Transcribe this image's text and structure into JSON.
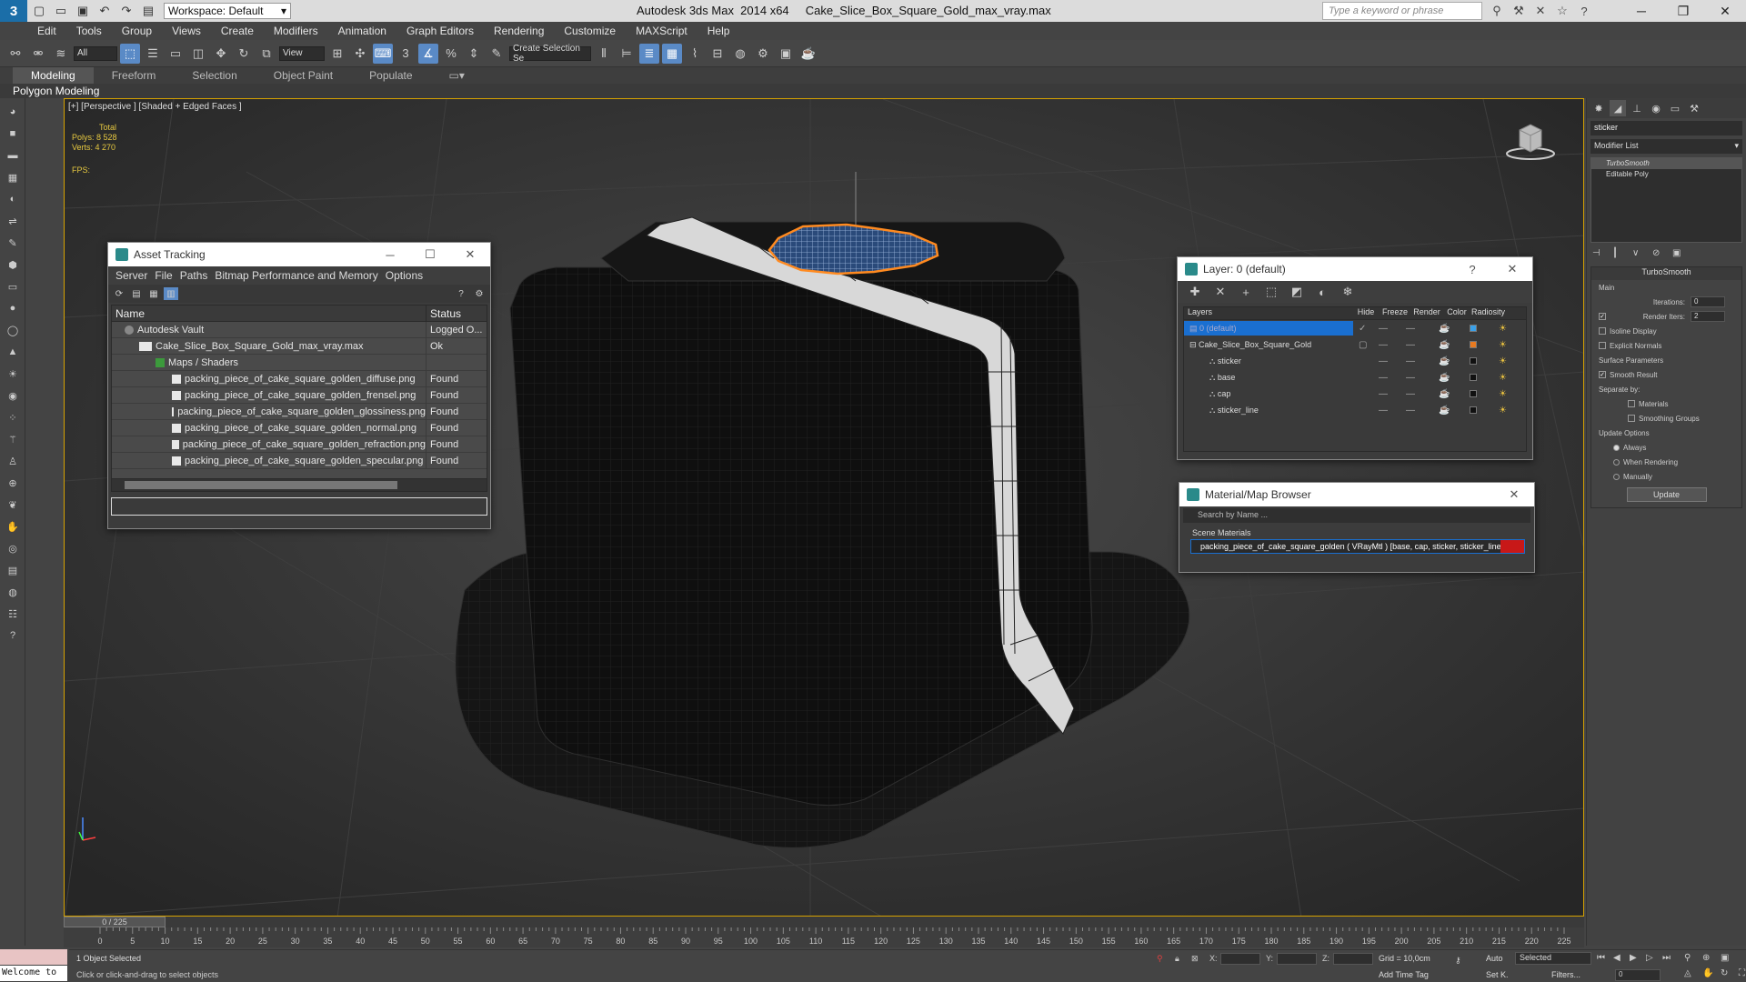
{
  "titlebar": {
    "workspace": "Workspace: Default",
    "title": "Autodesk 3ds Max  2014 x64     Cake_Slice_Box_Square_Gold_max_vray.max",
    "search_placeholder": "Type a keyword or phrase"
  },
  "menu": [
    "Edit",
    "Tools",
    "Group",
    "Views",
    "Create",
    "Modifiers",
    "Animation",
    "Graph Editors",
    "Rendering",
    "Customize",
    "MAXScript",
    "Help"
  ],
  "toolbar": {
    "filter": "All",
    "ref_coord": "View",
    "named_selection": "Create Selection Se"
  },
  "ribbon": {
    "tabs": [
      "Modeling",
      "Freeform",
      "Selection",
      "Object Paint",
      "Populate"
    ],
    "active_tab": "Modeling",
    "sub_label": "Polygon Modeling"
  },
  "viewport": {
    "label": "[+] [Perspective ] [Shaded + Edged Faces ]",
    "stats_total": "Total",
    "polys_label": "Polys:",
    "polys_value": "8 528",
    "verts_label": "Verts:",
    "verts_value": "4 270",
    "fps_label": "FPS:"
  },
  "asset_tracking": {
    "title": "Asset Tracking",
    "menu": [
      "Server",
      "File",
      "Paths",
      "Bitmap Performance and Memory",
      "Options"
    ],
    "columns": [
      "Name",
      "Status"
    ],
    "rows": [
      {
        "name": "Autodesk Vault",
        "status": "Logged O..."
      },
      {
        "name": "Cake_Slice_Box_Square_Gold_max_vray.max",
        "status": "Ok"
      },
      {
        "name": "Maps / Shaders",
        "status": ""
      },
      {
        "name": "packing_piece_of_cake_square_golden_diffuse.png",
        "status": "Found"
      },
      {
        "name": "packing_piece_of_cake_square_golden_frensel.png",
        "status": "Found"
      },
      {
        "name": "packing_piece_of_cake_square_golden_glossiness.png",
        "status": "Found"
      },
      {
        "name": "packing_piece_of_cake_square_golden_normal.png",
        "status": "Found"
      },
      {
        "name": "packing_piece_of_cake_square_golden_refraction.png",
        "status": "Found"
      },
      {
        "name": "packing_piece_of_cake_square_golden_specular.png",
        "status": "Found"
      }
    ]
  },
  "layer_window": {
    "title": "Layer: 0 (default)",
    "columns": [
      "Layers",
      "Hide",
      "Freeze",
      "Render",
      "Color",
      "Radiosity"
    ],
    "rows": [
      {
        "name": "0 (default)",
        "color": "#3aa0e8"
      },
      {
        "name": "Cake_Slice_Box_Square_Gold",
        "color": "#e87a20"
      },
      {
        "name": "sticker",
        "color": "#111111"
      },
      {
        "name": "base",
        "color": "#111111"
      },
      {
        "name": "cap",
        "color": "#111111"
      },
      {
        "name": "sticker_line",
        "color": "#111111"
      }
    ]
  },
  "material_browser": {
    "title": "Material/Map Browser",
    "search_placeholder": "Search by Name ...",
    "group": "Scene Materials",
    "item": "packing_piece_of_cake_square_golden ( VRayMtl ) [base, cap, sticker, sticker_line]"
  },
  "command_panel": {
    "object_name": "sticker",
    "modifier_list": "Modifier List",
    "stack": [
      "TurboSmooth",
      "Editable Poly"
    ],
    "turbosmooth_title": "TurboSmooth",
    "main_label": "Main",
    "iterations_label": "Iterations:",
    "iterations_value": "0",
    "render_iters_label": "Render Iters:",
    "render_iters_value": "2",
    "isoline": "Isoline Display",
    "explicit_normals": "Explicit Normals",
    "surface_params": "Surface Parameters",
    "smooth_result": "Smooth Result",
    "separate_by": "Separate by:",
    "materials": "Materials",
    "smoothing_groups": "Smoothing Groups",
    "update_options": "Update Options",
    "always": "Always",
    "when_rendering": "When Rendering",
    "manually": "Manually",
    "update_button": "Update"
  },
  "timeline": {
    "frame": "0 / 225",
    "ticks": [
      "0",
      "5",
      "10",
      "15",
      "20",
      "25",
      "30",
      "35",
      "40",
      "45",
      "50",
      "55",
      "60",
      "65",
      "70",
      "75",
      "80",
      "85",
      "90",
      "95",
      "100",
      "105",
      "110",
      "115",
      "120",
      "125",
      "130",
      "135",
      "140",
      "145",
      "150",
      "155",
      "160",
      "165",
      "170",
      "175",
      "180",
      "185",
      "190",
      "195",
      "200",
      "205",
      "210",
      "215",
      "220",
      "225"
    ]
  },
  "status": {
    "listener": "Welcome to",
    "selection": "1 Object Selected",
    "prompt": "Click or click-and-drag to select objects",
    "x_label": "X:",
    "y_label": "Y:",
    "z_label": "Z:",
    "grid": "Grid = 10,0cm",
    "add_time_tag": "Add Time Tag",
    "auto": "Auto",
    "selected": "Selected",
    "set_k": "Set K.",
    "filters": "Filters...",
    "frame_value": "0"
  },
  "colors": {
    "accent": "#5a8ac6",
    "viewport_border": "#d6a200",
    "stats": "#e6c840",
    "selection": "#1a6fd0"
  }
}
